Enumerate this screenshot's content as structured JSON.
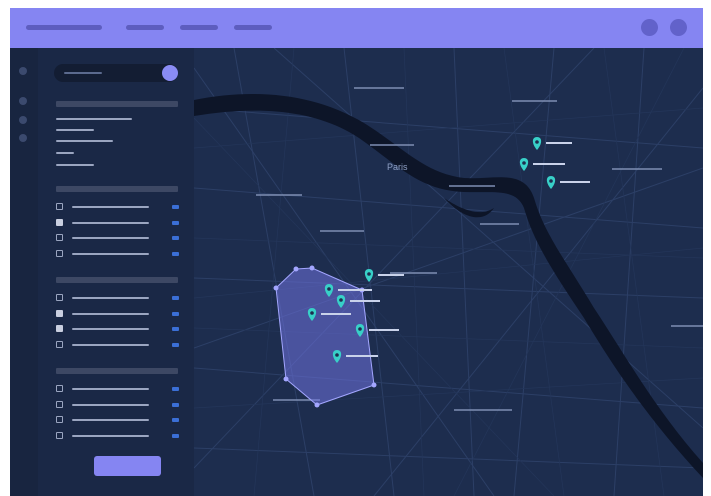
{
  "map": {
    "city_label": "Paris"
  },
  "colors": {
    "accent": "#8585f2",
    "panel": "#1a2846",
    "map_background": "#1d2d4e",
    "river": "#0d1528",
    "marker": "#38d0c8",
    "selection_fill": "#6f73e0"
  },
  "icons": {
    "marker": "map-pin-icon",
    "avatar": "user-avatar-icon"
  },
  "filters": {
    "group_1": [
      {
        "checked": false
      },
      {
        "checked": true
      },
      {
        "checked": false
      },
      {
        "checked": false
      }
    ],
    "group_2": [
      {
        "checked": false
      },
      {
        "checked": true
      },
      {
        "checked": true
      },
      {
        "checked": false
      }
    ],
    "group_3": [
      {
        "checked": false
      },
      {
        "checked": false
      },
      {
        "checked": false
      },
      {
        "checked": false
      }
    ]
  }
}
